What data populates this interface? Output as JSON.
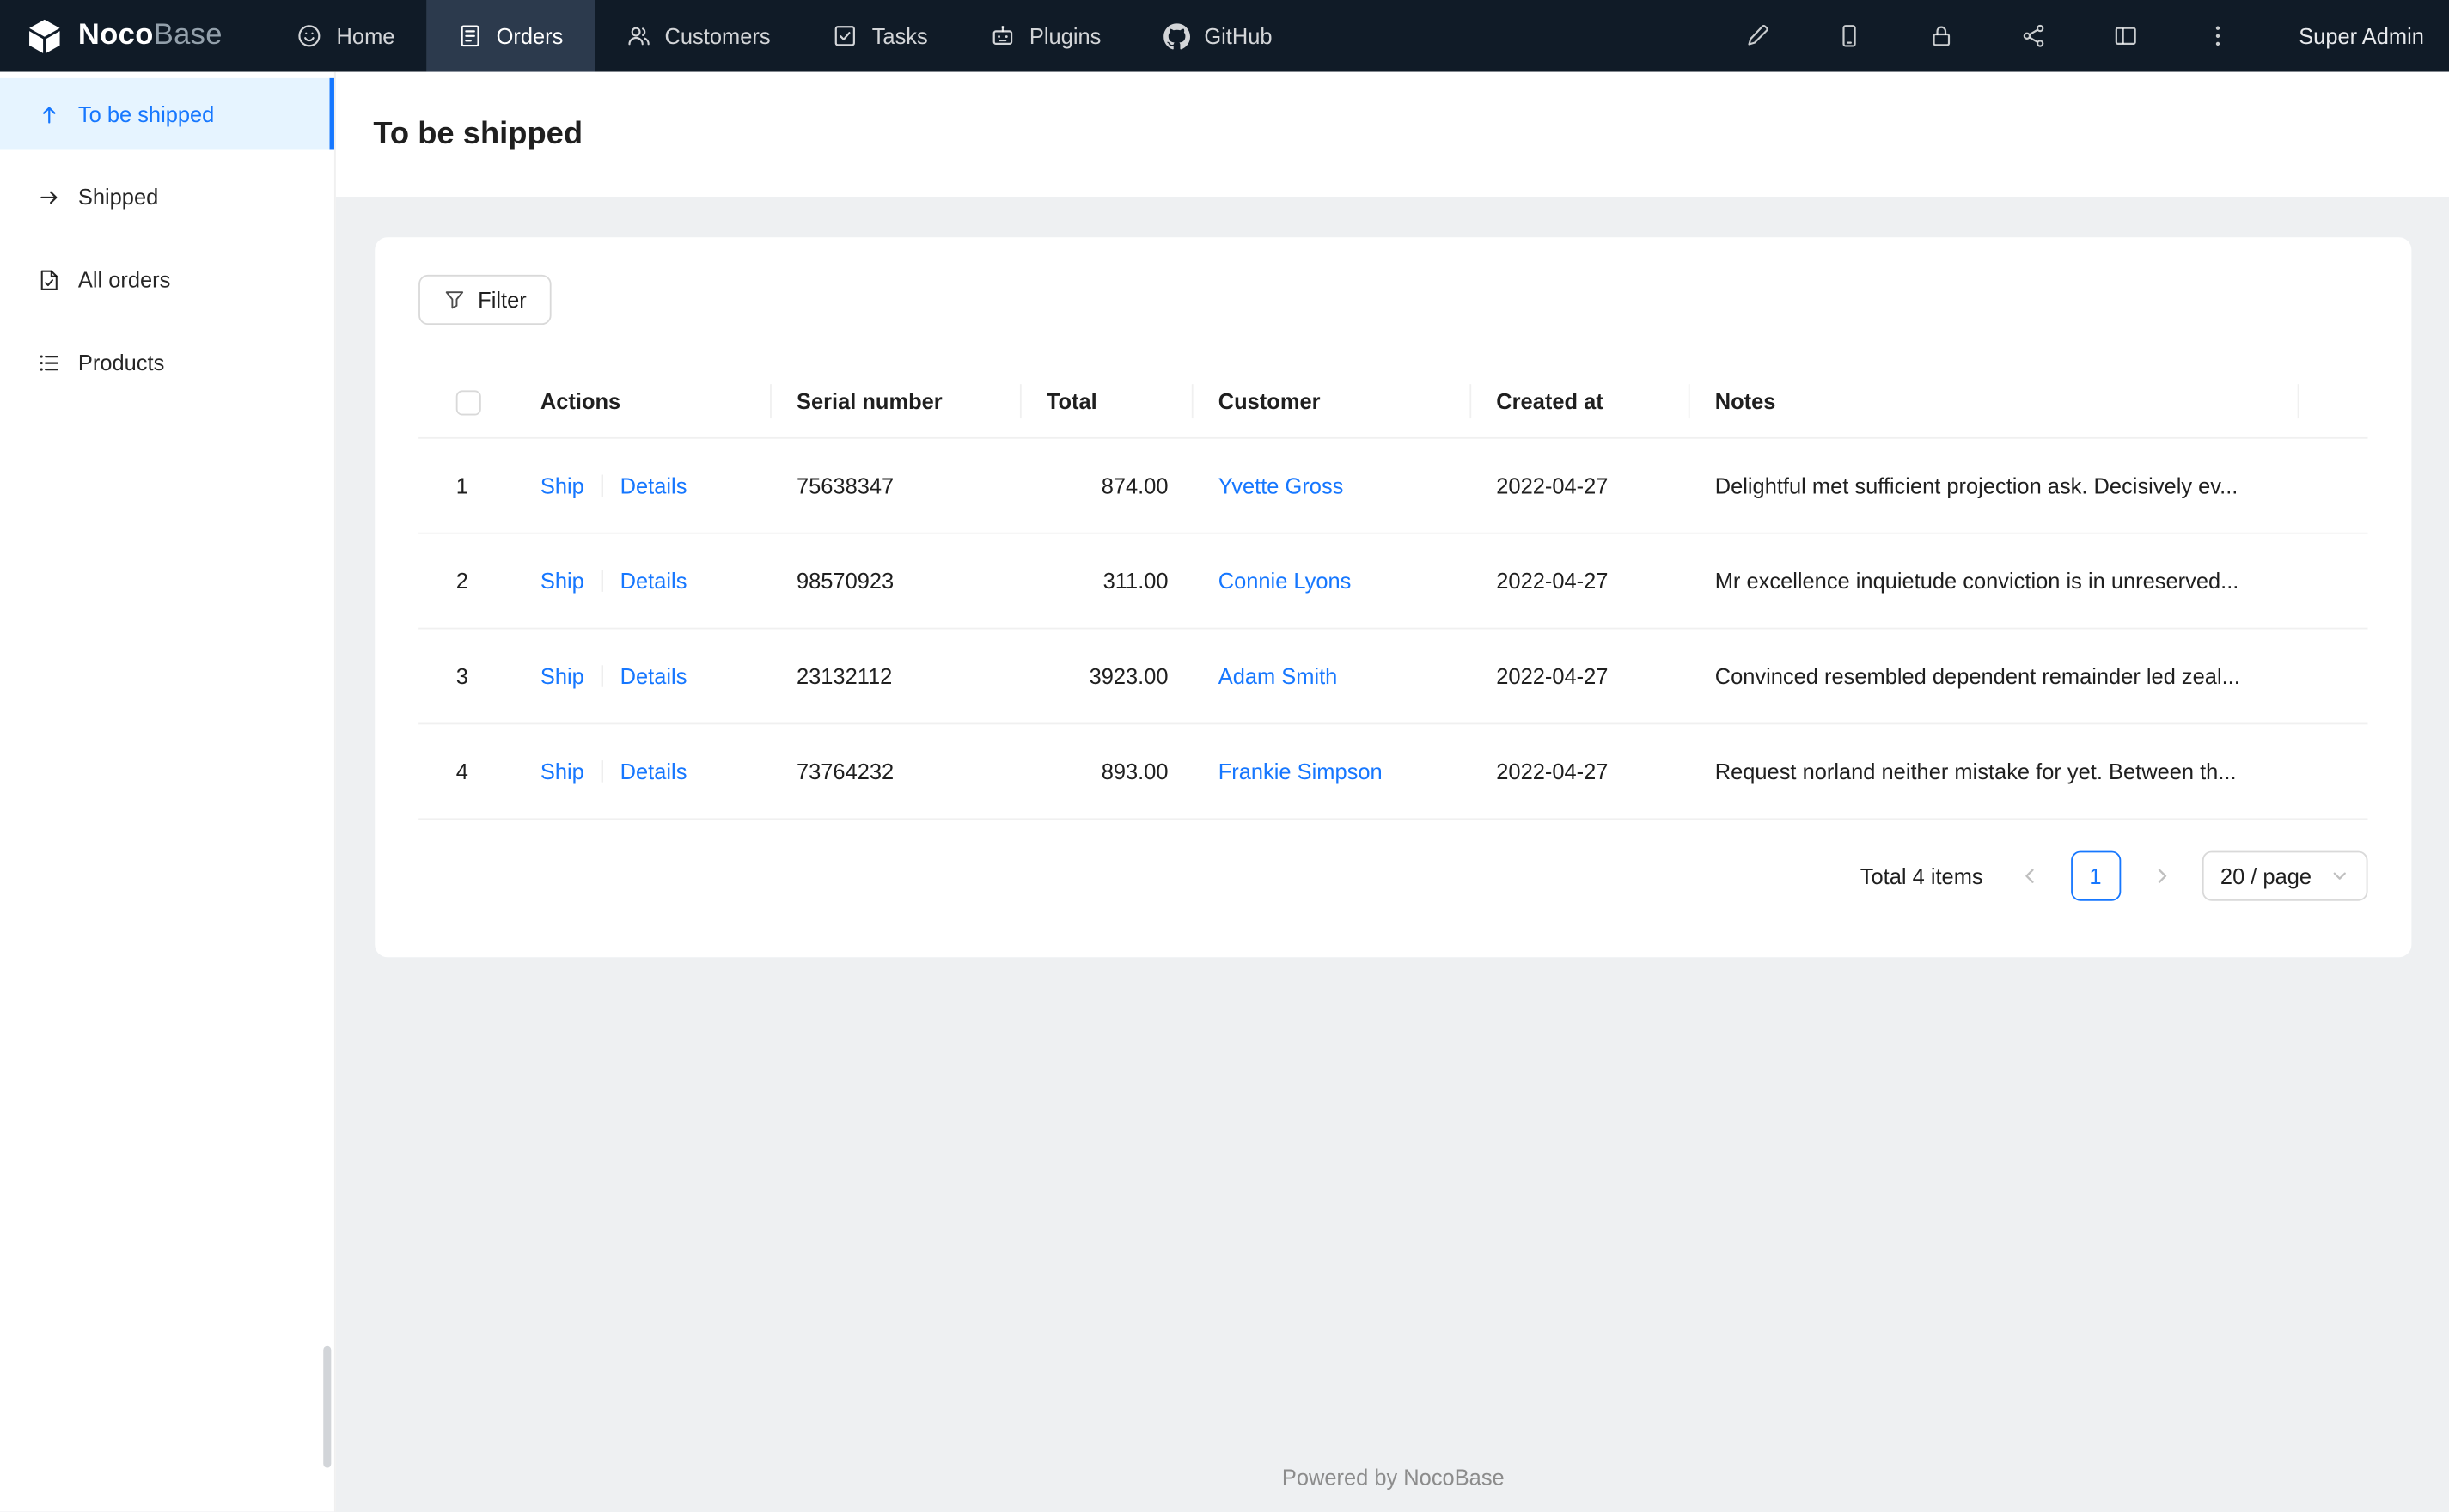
{
  "colors": {
    "accent": "#1677ff",
    "link": "#1677ff",
    "navbar_bg": "#101b27",
    "navbar_active_bg": "#2c3a4d",
    "sidebar_active_bg": "#e6f4ff",
    "content_bg": "#eef0f2"
  },
  "navbar": {
    "logo_bold": "Noco",
    "logo_light": "Base",
    "items": [
      {
        "label": "Home"
      },
      {
        "label": "Orders"
      },
      {
        "label": "Customers"
      },
      {
        "label": "Tasks"
      },
      {
        "label": "Plugins"
      },
      {
        "label": "GitHub"
      }
    ],
    "user": "Super Admin"
  },
  "sidebar": {
    "items": [
      {
        "label": "To be shipped"
      },
      {
        "label": "Shipped"
      },
      {
        "label": "All orders"
      },
      {
        "label": "Products"
      }
    ]
  },
  "page": {
    "title": "To be shipped"
  },
  "toolbar": {
    "filter_label": "Filter"
  },
  "table": {
    "headers": [
      "Actions",
      "Serial number",
      "Total",
      "Customer",
      "Created at",
      "Notes"
    ],
    "rows": [
      {
        "index": "1",
        "action_ship": "Ship",
        "action_details": "Details",
        "serial": "75638347",
        "total": "874.00",
        "customer": "Yvette Gross",
        "created_at": "2022-04-27",
        "notes": "Delightful met sufficient projection ask. Decisively ev..."
      },
      {
        "index": "2",
        "action_ship": "Ship",
        "action_details": "Details",
        "serial": "98570923",
        "total": "311.00",
        "customer": "Connie Lyons",
        "created_at": "2022-04-27",
        "notes": "Mr excellence inquietude conviction is in unreserved..."
      },
      {
        "index": "3",
        "action_ship": "Ship",
        "action_details": "Details",
        "serial": "23132112",
        "total": "3923.00",
        "customer": "Adam Smith",
        "created_at": "2022-04-27",
        "notes": "Convinced resembled dependent remainder led zeal..."
      },
      {
        "index": "4",
        "action_ship": "Ship",
        "action_details": "Details",
        "serial": "73764232",
        "total": "893.00",
        "customer": "Frankie Simpson",
        "created_at": "2022-04-27",
        "notes": "Request norland neither mistake for yet. Between th..."
      }
    ]
  },
  "pagination": {
    "total_text": "Total 4 items",
    "current_page": "1",
    "page_size": "20 / page"
  },
  "footer": {
    "text": "Powered by NocoBase"
  }
}
